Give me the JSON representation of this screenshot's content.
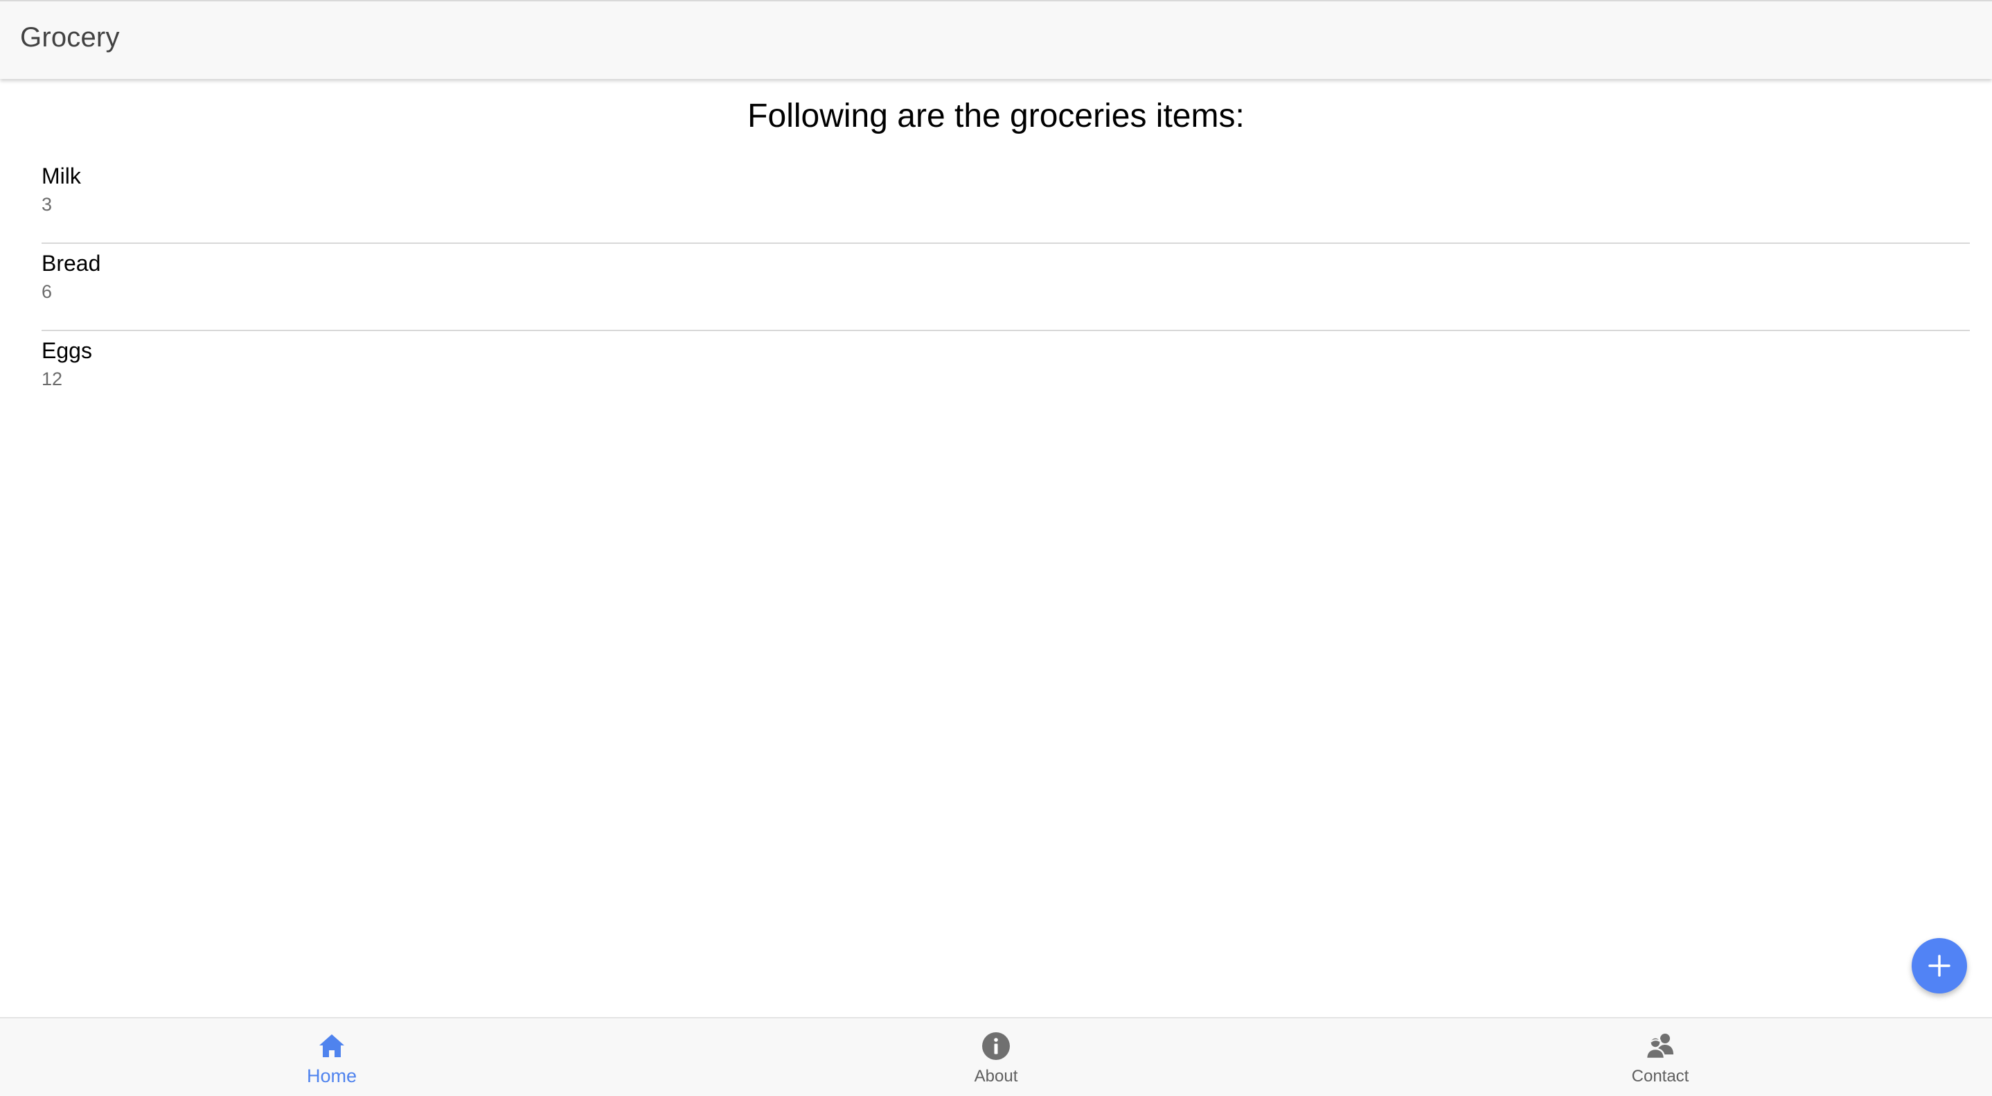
{
  "app": {
    "title": "Grocery",
    "accent_color": "#5183f5"
  },
  "main": {
    "heading": "Following are the groceries items:",
    "items": [
      {
        "name": "Milk",
        "quantity": "3"
      },
      {
        "name": "Bread",
        "quantity": "6"
      },
      {
        "name": "Eggs",
        "quantity": "12"
      }
    ]
  },
  "fab": {
    "icon": "plus-icon"
  },
  "bottom_nav": {
    "active": "Home",
    "items": [
      {
        "label": "Home",
        "icon": "home-icon"
      },
      {
        "label": "About",
        "icon": "info-icon"
      },
      {
        "label": "Contact",
        "icon": "contacts-icon"
      }
    ]
  }
}
